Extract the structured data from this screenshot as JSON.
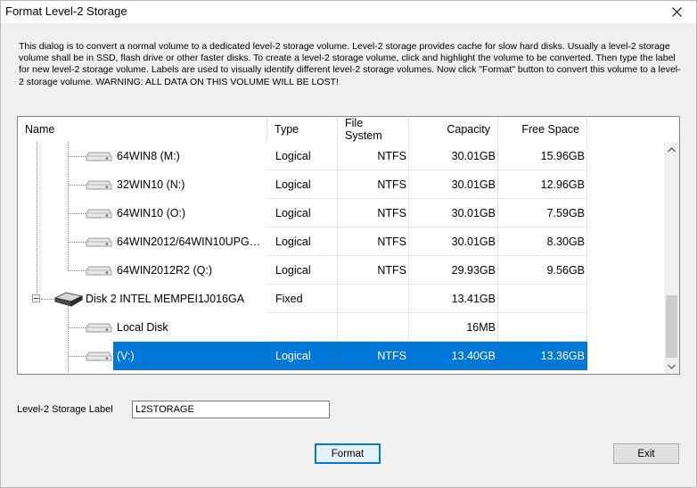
{
  "window": {
    "title": "Format Level-2 Storage",
    "close_icon": "close-icon"
  },
  "description": "This dialog is to convert a normal volume to a dedicated level-2 storage volume. Level-2 storage provides cache for slow hard disks. Usually a level-2 storage volume shall be in SSD, flash drive or other faster disks. To create a level-2 storage volume, click and highlight the volume to be converted. Then type the label for new level-2 storage volume. Labels are used to visually identify different level-2 storage volumes. Now click \"Format\" button to convert this volume to a level-2 storage volume. WARNING: ALL DATA ON THIS VOLUME WILL BE LOST!",
  "table": {
    "columns": [
      "Name",
      "Type",
      "File System",
      "Capacity",
      "Free Space"
    ],
    "rows": [
      {
        "name": "64WIN8 (M:)",
        "type": "Logical",
        "fs": "NTFS",
        "capacity": "30.01GB",
        "free": "15.96GB",
        "icon": "drive-icon",
        "selected": false
      },
      {
        "name": "32WIN10 (N:)",
        "type": "Logical",
        "fs": "NTFS",
        "capacity": "30.01GB",
        "free": "12.96GB",
        "icon": "drive-icon",
        "selected": false
      },
      {
        "name": "64WIN10 (O:)",
        "type": "Logical",
        "fs": "NTFS",
        "capacity": "30.01GB",
        "free": "7.59GB",
        "icon": "drive-icon",
        "selected": false
      },
      {
        "name": "64WIN2012/64WIN10UPG…",
        "type": "Logical",
        "fs": "NTFS",
        "capacity": "30.01GB",
        "free": "8.30GB",
        "icon": "drive-icon",
        "selected": false
      },
      {
        "name": "64WIN2012R2 (Q:)",
        "type": "Logical",
        "fs": "NTFS",
        "capacity": "29.93GB",
        "free": "9.56GB",
        "icon": "drive-icon",
        "selected": false
      },
      {
        "name": "Disk 2 INTEL MEMPEI1J016GA",
        "type": "Fixed",
        "fs": "",
        "capacity": "13.41GB",
        "free": "",
        "icon": "disk-icon",
        "selected": false
      },
      {
        "name": "Local Disk",
        "type": "",
        "fs": "",
        "capacity": "16MB",
        "free": "",
        "icon": "drive-icon",
        "selected": false
      },
      {
        "name": "(V:)",
        "type": "Logical",
        "fs": "NTFS",
        "capacity": "13.40GB",
        "free": "13.36GB",
        "icon": "drive-icon",
        "selected": true
      }
    ]
  },
  "label_field": {
    "label": "Level-2 Storage Label",
    "value": "L2STORAGE"
  },
  "buttons": {
    "format": "Format",
    "exit": "Exit"
  },
  "colors": {
    "selection": "#0078d7",
    "dialog_bg": "#f0f0f0"
  }
}
